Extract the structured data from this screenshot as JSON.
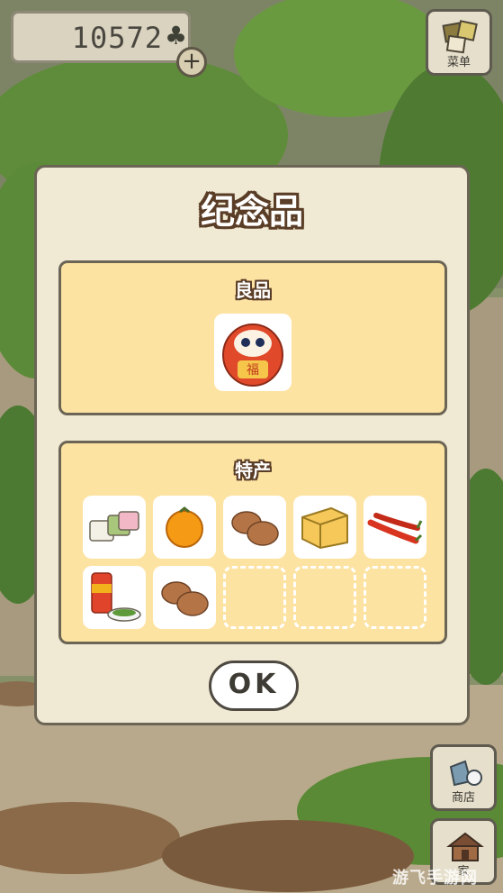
{
  "hud": {
    "clover_count": "10572",
    "clover_symbol": "♣",
    "plus_symbol": "+"
  },
  "side_buttons": {
    "menu_label": "菜单",
    "shop_label": "商店",
    "home_label": "家"
  },
  "dialog": {
    "title": "纪念品",
    "good_section_title": "良品",
    "good_items": [
      {
        "icon": "daruma-icon"
      }
    ],
    "special_section_title": "特产",
    "special_items": [
      {
        "icon": "mochi-icon"
      },
      {
        "icon": "orange-icon"
      },
      {
        "icon": "manju-icon"
      },
      {
        "icon": "cheese-icon"
      },
      {
        "icon": "chili-pepper-icon"
      },
      {
        "icon": "canned-tea-icon"
      },
      {
        "icon": "steamed-buns-icon"
      },
      {
        "icon": "empty-slot"
      },
      {
        "icon": "empty-slot"
      },
      {
        "icon": "empty-slot"
      }
    ],
    "ok_label": "OK"
  },
  "watermark": "游飞手游网",
  "colors": {
    "dialog_bg": "#f0e9d3",
    "panel_bg": "#fde3a2",
    "border": "#6b6556",
    "title_outline": "#5a3d26"
  }
}
